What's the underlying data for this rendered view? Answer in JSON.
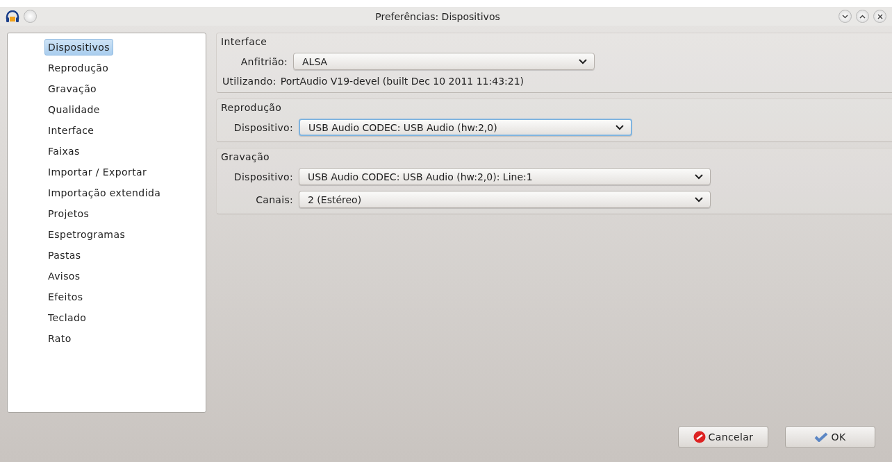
{
  "window": {
    "title": "Preferências: Dispositivos"
  },
  "sidebar": {
    "items": [
      {
        "label": "Dispositivos",
        "selected": true
      },
      {
        "label": "Reprodução",
        "selected": false
      },
      {
        "label": "Gravação",
        "selected": false
      },
      {
        "label": "Qualidade",
        "selected": false
      },
      {
        "label": "Interface",
        "selected": false
      },
      {
        "label": "Faixas",
        "selected": false
      },
      {
        "label": "Importar / Exportar",
        "selected": false
      },
      {
        "label": "Importação extendida",
        "selected": false
      },
      {
        "label": "Projetos",
        "selected": false
      },
      {
        "label": "Espetrogramas",
        "selected": false
      },
      {
        "label": "Pastas",
        "selected": false
      },
      {
        "label": "Avisos",
        "selected": false
      },
      {
        "label": "Efeitos",
        "selected": false
      },
      {
        "label": "Teclado",
        "selected": false
      },
      {
        "label": "Rato",
        "selected": false
      }
    ]
  },
  "groups": [
    {
      "title": "Interface",
      "rows": [
        {
          "kind": "dropdown",
          "label": "Anfitrião:",
          "value": "ALSA",
          "focused": false
        },
        {
          "kind": "info",
          "label": "Utilizando:",
          "value": "PortAudio V19-devel (built Dec 10 2011 11:43:21)"
        }
      ]
    },
    {
      "title": "Reprodução",
      "rows": [
        {
          "kind": "dropdown",
          "label": "Dispositivo:",
          "value": "USB Audio CODEC: USB Audio (hw:2,0)",
          "focused": true
        }
      ]
    },
    {
      "title": "Gravação",
      "rows": [
        {
          "kind": "dropdown",
          "label": "Dispositivo:",
          "value": "USB Audio CODEC: USB Audio (hw:2,0): Line:1",
          "focused": false
        },
        {
          "kind": "dropdown",
          "label": "Canais:",
          "value": "2 (Estéreo)",
          "focused": false
        }
      ]
    }
  ],
  "buttons": [
    {
      "kind": "cancel",
      "label": "Cancelar"
    },
    {
      "kind": "ok",
      "label": "OK"
    }
  ]
}
